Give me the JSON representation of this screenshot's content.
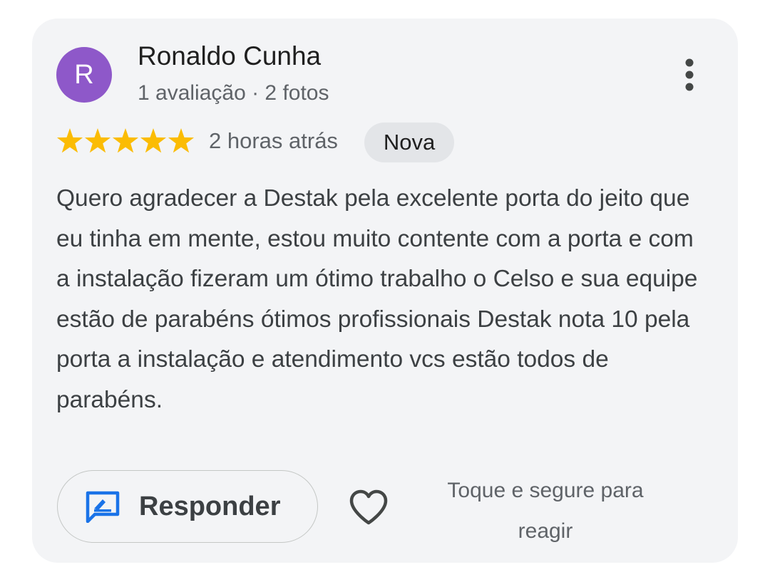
{
  "review": {
    "author": {
      "initial": "R",
      "name": "Ronaldo Cunha",
      "meta": "1 avaliação · 2 fotos",
      "avatar_color": "#8e58c9"
    },
    "menu_icon": "more-vert-icon",
    "rating": 5,
    "rating_max": 5,
    "star_color": "#fbbc04",
    "time": "2 horas atrás",
    "badge": "Nova",
    "text": "Quero agradecer a Destak pela excelente porta do jeito que eu tinha em mente, estou muito contente com a porta e com a instalação fizeram um ótimo trabalho o Celso e sua equipe estão de parabéns ótimos profissionais Destak nota 10 pela porta a instalação e atendimento vcs estão todos de parabéns."
  },
  "actions": {
    "reply_label": "Responder",
    "reply_icon": "reply-icon",
    "reply_icon_color": "#1a73e8",
    "heart_icon": "heart-outline-icon",
    "react_hint": "Toque e segure para reagir"
  }
}
